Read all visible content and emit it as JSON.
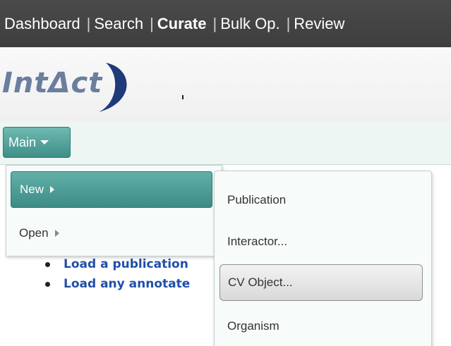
{
  "topnav": {
    "items": [
      {
        "label": "Dashboard",
        "active": false
      },
      {
        "label": "Search",
        "active": false
      },
      {
        "label": "Curate",
        "active": true
      },
      {
        "label": "Bulk Op.",
        "active": false
      },
      {
        "label": "Review",
        "active": false
      }
    ],
    "separator": "|"
  },
  "logo": {
    "text": "IntΔct",
    "brand_color": "#6a7e9e",
    "swoosh_color": "#1f3a78"
  },
  "menubar": {
    "main_label": "Main",
    "main_icon": "caret-down-icon"
  },
  "main_menu": {
    "items": [
      {
        "label": "New",
        "selected": true,
        "icon": "submenu-arrow-icon"
      },
      {
        "label": "Open",
        "selected": false,
        "icon": "submenu-arrow-icon"
      }
    ]
  },
  "new_submenu": {
    "items": [
      {
        "label": "Publication",
        "hover": false
      },
      {
        "label": "Interactor...",
        "hover": false
      },
      {
        "label": "CV Object...",
        "hover": true
      },
      {
        "label": "Organism",
        "hover": false
      }
    ]
  },
  "content": {
    "links": [
      {
        "label": "Load a publication"
      },
      {
        "label": "Load any annotate"
      }
    ]
  },
  "colors": {
    "topnav_bg": "#434343",
    "accent_teal": "#4f9e97",
    "link_blue": "#1f4fa8"
  }
}
